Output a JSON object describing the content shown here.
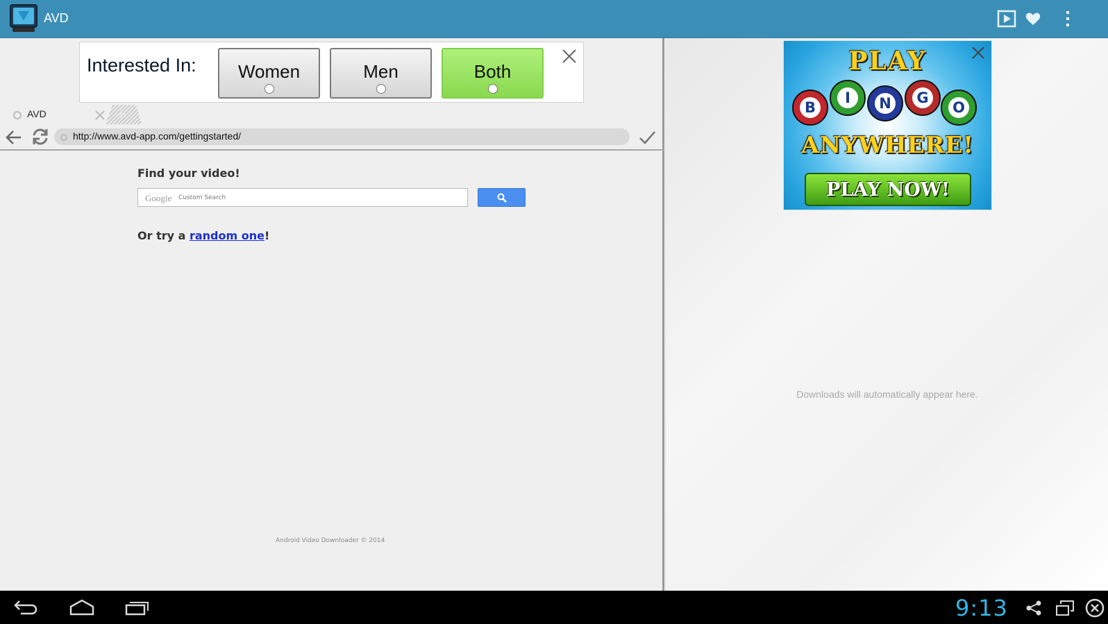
{
  "app": {
    "title": "AVD",
    "colors": {
      "action_bar": "#3b8fb6",
      "clock": "#33b5e5"
    }
  },
  "action_bar": {
    "icons": [
      "play-video-icon",
      "heart-icon",
      "overflow-menu-icon"
    ]
  },
  "interest_ad": {
    "label": "Interested In:",
    "options": [
      {
        "label": "Women",
        "selected": false
      },
      {
        "label": "Men",
        "selected": false
      },
      {
        "label": "Both",
        "selected": true
      }
    ]
  },
  "browser": {
    "tab": {
      "title": "AVD"
    },
    "url": "http://www.avd-app.com/gettingstarted/"
  },
  "page": {
    "heading": "Find your video!",
    "search": {
      "brand": "Google",
      "placeholder": "Custom Search",
      "button_icon": "magnifier-icon"
    },
    "try_prefix": "Or try a ",
    "try_link": "random one",
    "try_suffix": "!",
    "footer": "Android Video Downloader © 2014"
  },
  "bingo_ad": {
    "headline": "PLAY",
    "balls": [
      "B",
      "I",
      "N",
      "G",
      "O"
    ],
    "tagline": "ANYWHERE!",
    "cta": "PLAY NOW!"
  },
  "downloads": {
    "empty_message": "Downloads will automatically appear here."
  },
  "system_bar": {
    "clock": "9:13"
  }
}
